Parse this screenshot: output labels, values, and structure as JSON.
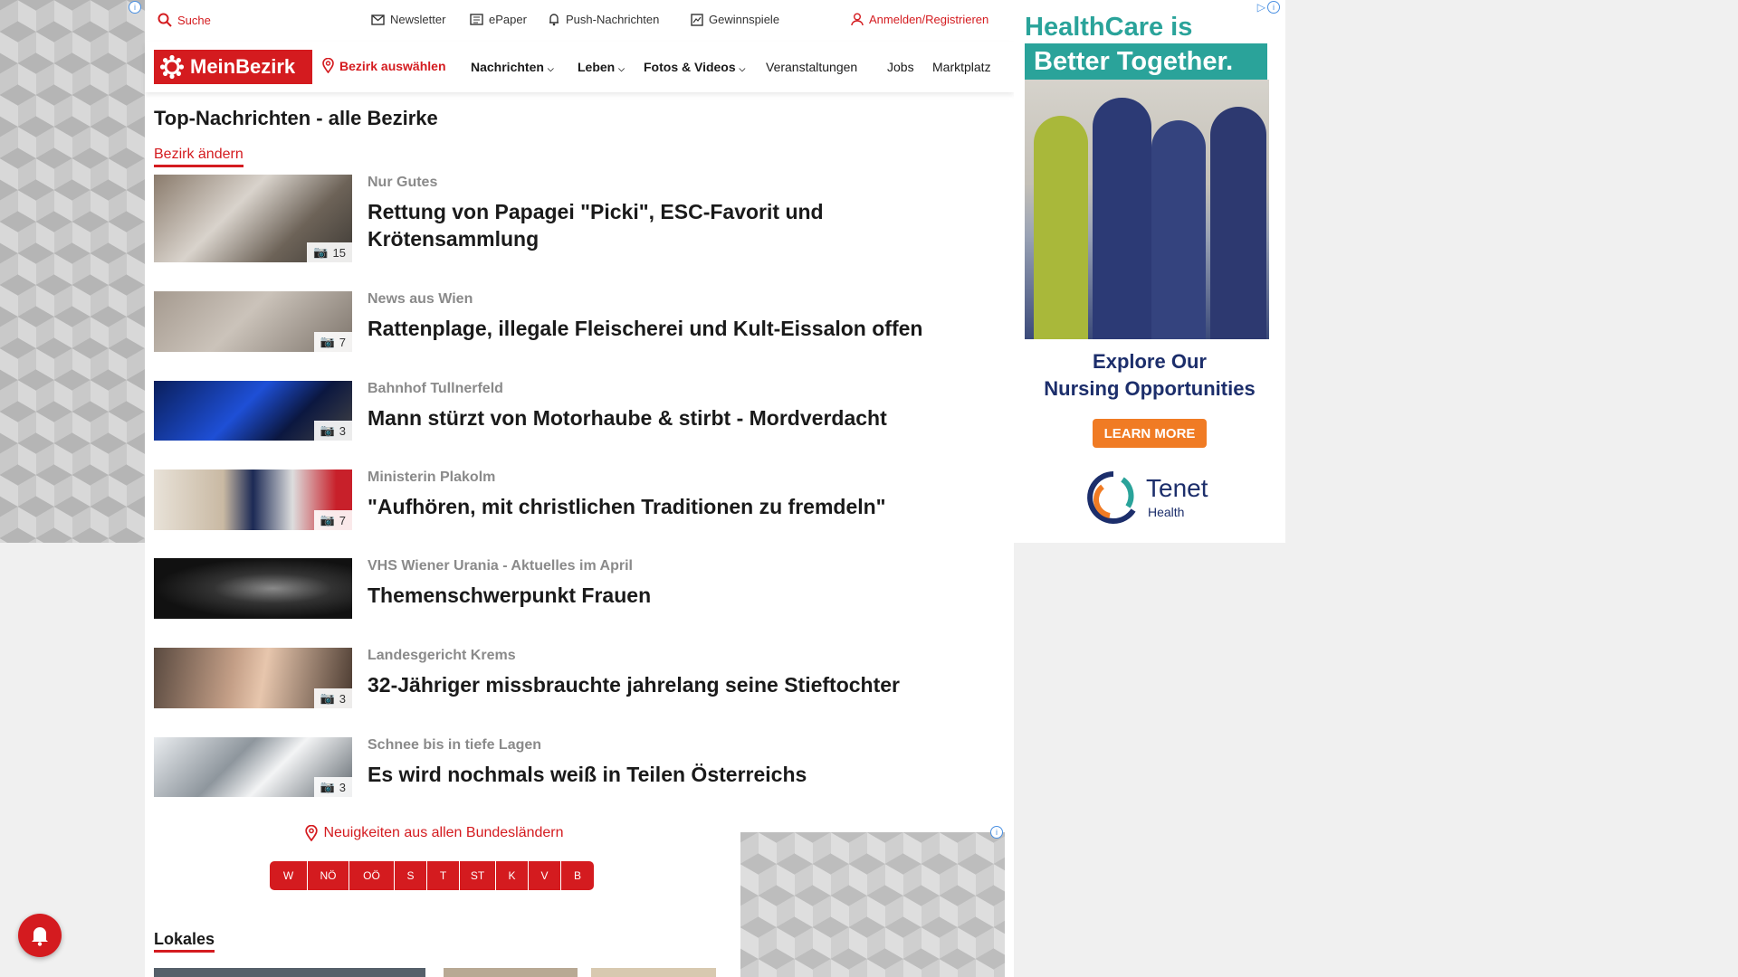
{
  "topbar": {
    "search": "Suche",
    "newsletter": "Newsletter",
    "epaper": "ePaper",
    "push": "Push-Nachrichten",
    "contests": "Gewinnspiele",
    "login": "Anmelden/Registrieren"
  },
  "nav": {
    "logo": "MeinBezirk",
    "district_select": "Bezirk auswählen",
    "items": [
      "Nachrichten",
      "Leben",
      "Fotos & Videos",
      "Veranstaltungen",
      "Jobs",
      "Marktplatz"
    ]
  },
  "page": {
    "title": "Top-Nachrichten - alle Bezirke",
    "change_district": "Bezirk ändern"
  },
  "articles": [
    {
      "kicker": "Nur Gutes",
      "headline": "Rettung von Papagei \"Picki\", ESC-Favorit und Krötensammlung",
      "count": "15"
    },
    {
      "kicker": "News aus Wien",
      "headline": "Rattenplage, illegale Fleischerei und Kult-Eissalon offen",
      "count": "7"
    },
    {
      "kicker": "Bahnhof Tullnerfeld",
      "headline": "Mann stürzt von Motorhaube & stirbt - Mordverdacht",
      "count": "3"
    },
    {
      "kicker": "Ministerin Plakolm",
      "headline": "\"Aufhören, mit christlichen Traditionen zu fremdeln\"",
      "count": "7"
    },
    {
      "kicker": "VHS Wiener Urania - Aktuelles im April",
      "headline": "Themenschwerpunkt Frauen",
      "count": ""
    },
    {
      "kicker": "Landesgericht Krems",
      "headline": "32-Jähriger missbrauchte jahrelang seine Stieftochter",
      "count": "3"
    },
    {
      "kicker": "Schnee bis in tiefe Lagen",
      "headline": "Es wird nochmals weiß in Teilen Österreichs",
      "count": "3"
    }
  ],
  "regions": {
    "label": "Neuigkeiten aus allen Bundesländern",
    "states": [
      "W",
      "NÖ",
      "OÖ",
      "S",
      "T",
      "ST",
      "K",
      "V",
      "B"
    ]
  },
  "section": {
    "title": "Lokales"
  },
  "ad": {
    "headline_1": "HealthCare is",
    "headline_2": "Better Together.",
    "cta_line_1": "Explore Our",
    "cta_line_2": "Nursing Opportunities",
    "button": "LEARN MORE",
    "brand": "Tenet",
    "brand_sub": "Health"
  },
  "colors": {
    "brand_red": "#d41b1f",
    "ad_teal": "#2aa39a",
    "ad_navy": "#1c2e6b",
    "ad_orange": "#f07b24"
  }
}
